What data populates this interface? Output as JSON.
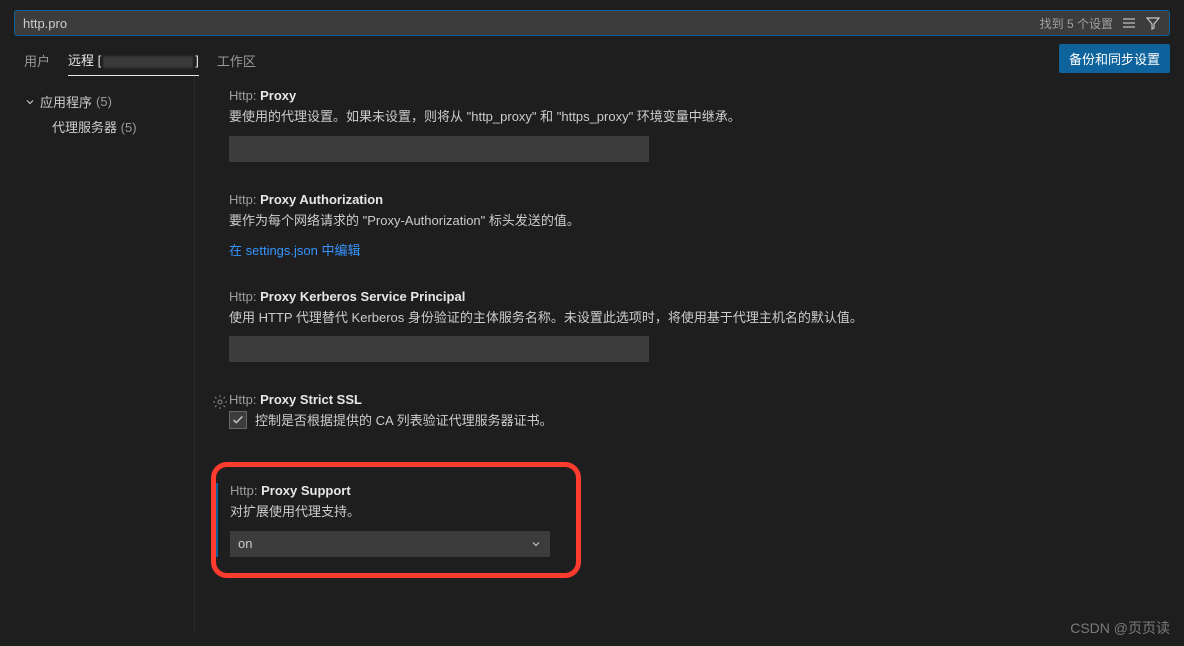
{
  "search": {
    "value": "http.pro",
    "result_text": "找到 5 个设置"
  },
  "tabs": {
    "user": "用户",
    "remote_prefix": "远程 [",
    "remote_suffix": "]",
    "workspace": "工作区"
  },
  "sync_button": "备份和同步设置",
  "sidebar": {
    "parent_label": "应用程序",
    "parent_count": "(5)",
    "child_label": "代理服务器",
    "child_count": "(5)"
  },
  "settings": {
    "proxy": {
      "cat": "Http:",
      "name": "Proxy",
      "desc": "要使用的代理设置。如果未设置，则将从 \"http_proxy\" 和 \"https_proxy\" 环境变量中继承。"
    },
    "proxy_auth": {
      "cat": "Http:",
      "name": "Proxy Authorization",
      "desc": "要作为每个网络请求的 \"Proxy-Authorization\" 标头发送的值。",
      "link": "在 settings.json 中编辑"
    },
    "kerberos": {
      "cat": "Http:",
      "name": "Proxy Kerberos Service Principal",
      "desc": "使用 HTTP 代理替代 Kerberos 身份验证的主体服务名称。未设置此选项时，将使用基于代理主机名的默认值。"
    },
    "strict_ssl": {
      "cat": "Http:",
      "name": "Proxy Strict SSL",
      "desc": "控制是否根据提供的 CA 列表验证代理服务器证书。"
    },
    "proxy_support": {
      "cat": "Http:",
      "name": "Proxy Support",
      "desc": "对扩展使用代理支持。",
      "value": "on"
    }
  },
  "watermark": "CSDN @页页读"
}
